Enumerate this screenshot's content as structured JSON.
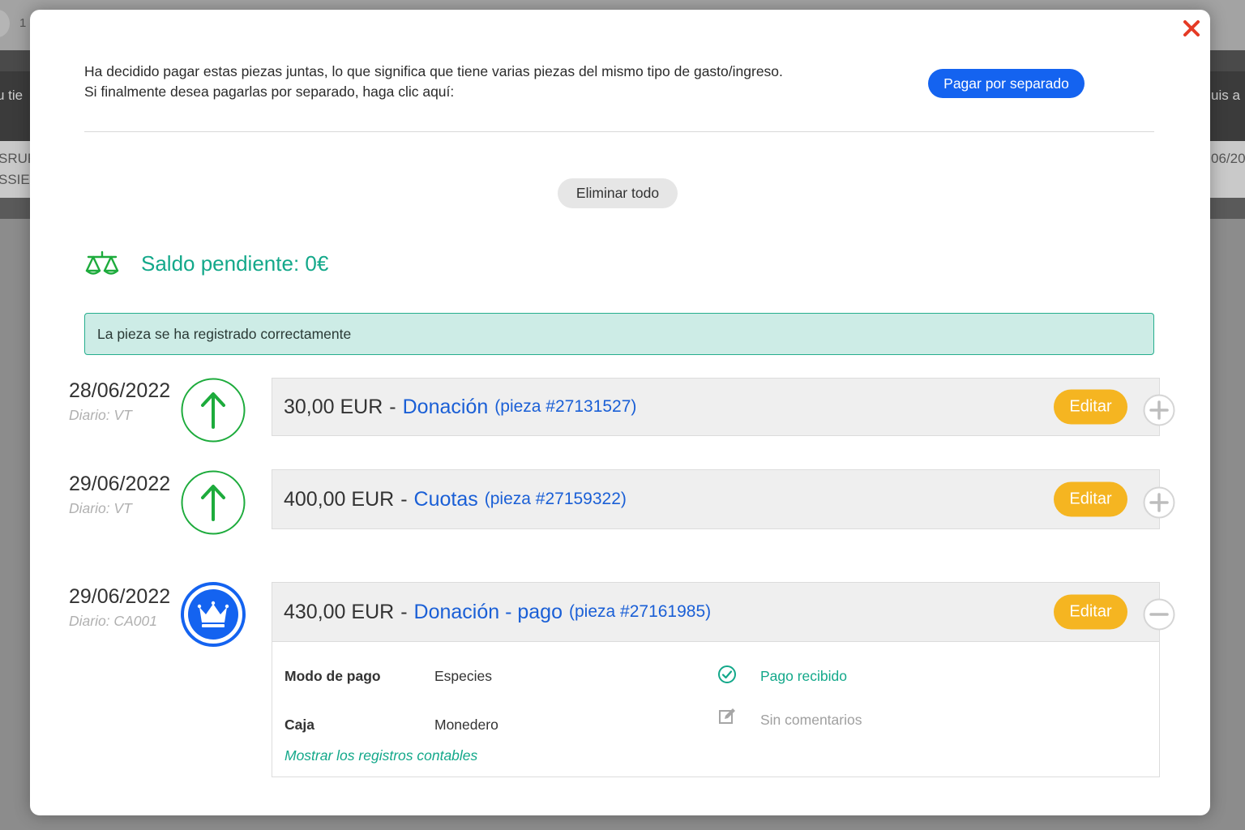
{
  "background": {
    "page_number_fragment": "1",
    "left_fragments": [
      "u tie",
      "SRUF",
      "SSIEA"
    ],
    "right_fragments": [
      "uis a",
      "06/20"
    ]
  },
  "modal": {
    "intro_line1": "Ha decidido pagar estas piezas juntas, lo que significa que tiene varias piezas del mismo tipo de gasto/ingreso.",
    "intro_line2": "Si finalmente desea pagarlas por separado, haga clic aquí:",
    "separate_button": "Pagar por separado",
    "delete_all_button": "Eliminar todo",
    "balance": "Saldo pendiente: 0€",
    "alert": "La pieza se ha registrado correctamente",
    "edit_label": "Editar",
    "colors": {
      "primary": "#1463f0",
      "success": "#13a88a",
      "income": "#1dab3c",
      "edit": "#f5b521",
      "close": "#e53a25"
    }
  },
  "rows": [
    {
      "date": "28/06/2022",
      "journal": "Diario: VT",
      "icon": "arrow-up-icon",
      "amount": "30,00 EUR",
      "separator": "-",
      "concept": "Donación",
      "piece": "(pieza #27131527)",
      "toggle": "plus-icon"
    },
    {
      "date": "29/06/2022",
      "journal": "Diario: VT",
      "icon": "arrow-up-icon",
      "amount": "400,00 EUR",
      "separator": "-",
      "concept": "Cuotas",
      "piece": "(pieza #27159322)",
      "toggle": "plus-icon"
    },
    {
      "date": "29/06/2022",
      "journal": "Diario: CA001",
      "icon": "crown-icon",
      "amount": "430,00 EUR",
      "separator": "-",
      "concept": "Donación - pago",
      "piece": "(pieza #27161985)",
      "toggle": "minus-icon"
    }
  ],
  "details": {
    "payment_mode_label": "Modo de pago",
    "payment_mode_value": "Especies",
    "cash_label": "Caja",
    "cash_value": "Monedero",
    "show_records_link": "Mostrar los registros contables",
    "payment_status": "Pago recibido",
    "comments_status": "Sin comentarios"
  }
}
